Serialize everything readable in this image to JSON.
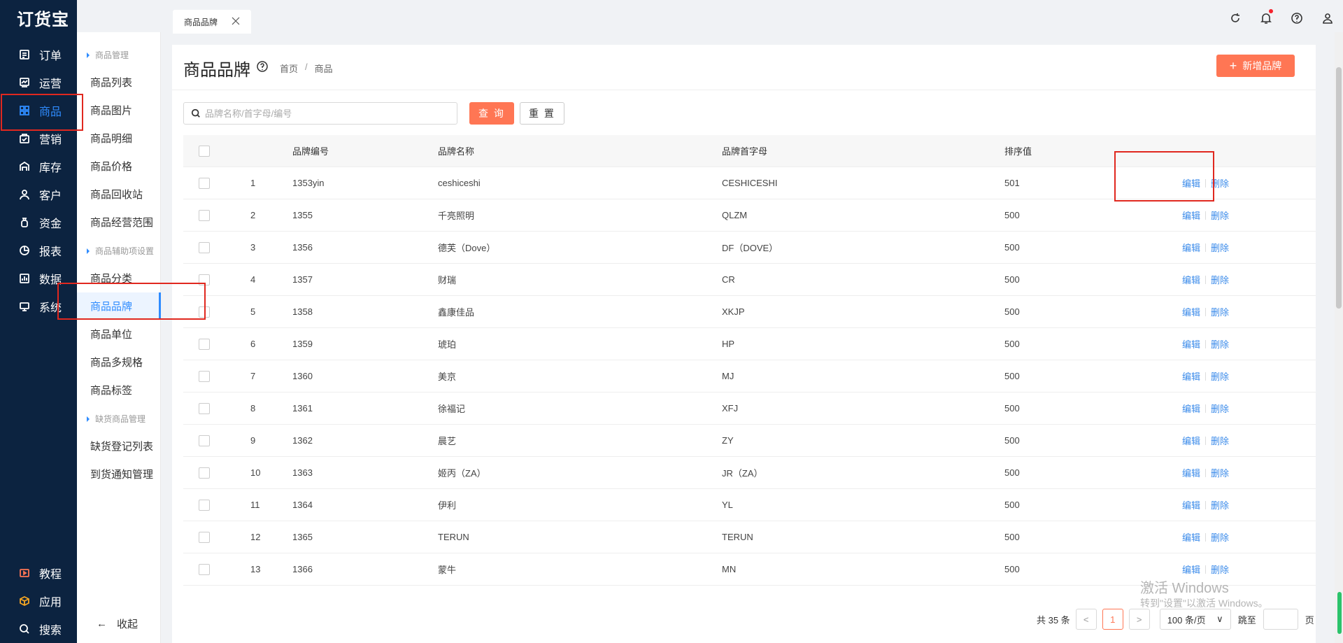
{
  "app": {
    "logo": "订货宝"
  },
  "nav": {
    "items": [
      {
        "label": "订单",
        "icon": "order-icon"
      },
      {
        "label": "运营",
        "icon": "operation-icon"
      },
      {
        "label": "商品",
        "icon": "product-grid-icon"
      },
      {
        "label": "营销",
        "icon": "marketing-icon"
      },
      {
        "label": "库存",
        "icon": "warehouse-icon"
      },
      {
        "label": "客户",
        "icon": "customer-icon"
      },
      {
        "label": "资金",
        "icon": "money-bag-icon"
      },
      {
        "label": "报表",
        "icon": "pie-chart-icon"
      },
      {
        "label": "数据",
        "icon": "data-icon"
      },
      {
        "label": "系统",
        "icon": "monitor-icon"
      }
    ],
    "bottom": [
      {
        "label": "教程",
        "icon": "play-icon"
      },
      {
        "label": "应用",
        "icon": "cube-icon"
      },
      {
        "label": "搜索",
        "icon": "search-icon"
      }
    ]
  },
  "submenu": {
    "groups": [
      "商品管理",
      "商品辅助项设置",
      "缺货商品管理"
    ],
    "items": [
      "商品列表",
      "商品图片",
      "商品明细",
      "商品价格",
      "商品回收站",
      "商品经营范围",
      "商品分类",
      "商品品牌",
      "商品单位",
      "商品多规格",
      "商品标签",
      "缺货登记列表",
      "到货通知管理"
    ],
    "collapse": "收起"
  },
  "tab": {
    "label": "商品品牌"
  },
  "page": {
    "title": "商品品牌",
    "breadcrumb": [
      "首页",
      "/",
      "商品"
    ],
    "add_button": "新增品牌",
    "search_placeholder": "品牌名称/首字母/编号",
    "query_button": "查 询",
    "reset_button": "重 置"
  },
  "table": {
    "headers": {
      "code": "品牌编号",
      "name": "品牌名称",
      "letter": "品牌首字母",
      "sort": "排序值"
    },
    "ops": {
      "edit": "编辑",
      "delete": "删除"
    },
    "rows": [
      {
        "idx": "1",
        "code": "1353yin",
        "name": "ceshiceshi",
        "letter": "CESHICESHI",
        "sort": "501"
      },
      {
        "idx": "2",
        "code": "1355",
        "name": "千亮照明",
        "letter": "QLZM",
        "sort": "500"
      },
      {
        "idx": "3",
        "code": "1356",
        "name": "德芙（Dove）",
        "letter": "DF（DOVE）",
        "sort": "500"
      },
      {
        "idx": "4",
        "code": "1357",
        "name": "财瑞",
        "letter": "CR",
        "sort": "500"
      },
      {
        "idx": "5",
        "code": "1358",
        "name": "鑫康佳品",
        "letter": "XKJP",
        "sort": "500"
      },
      {
        "idx": "6",
        "code": "1359",
        "name": "琥珀",
        "letter": "HP",
        "sort": "500"
      },
      {
        "idx": "7",
        "code": "1360",
        "name": "美京",
        "letter": "MJ",
        "sort": "500"
      },
      {
        "idx": "8",
        "code": "1361",
        "name": "徐福记",
        "letter": "XFJ",
        "sort": "500"
      },
      {
        "idx": "9",
        "code": "1362",
        "name": "晨艺",
        "letter": "ZY",
        "sort": "500"
      },
      {
        "idx": "10",
        "code": "1363",
        "name": "姬丙（ZA）",
        "letter": "JR（ZA）",
        "sort": "500"
      },
      {
        "idx": "11",
        "code": "1364",
        "name": "伊利",
        "letter": "YL",
        "sort": "500"
      },
      {
        "idx": "12",
        "code": "1365",
        "name": "TERUN",
        "letter": "TERUN",
        "sort": "500"
      },
      {
        "idx": "13",
        "code": "1366",
        "name": "蒙牛",
        "letter": "MN",
        "sort": "500"
      }
    ]
  },
  "pager": {
    "total": "共 35 条",
    "current": "1",
    "page_size": "100 条/页",
    "jump": "跳至",
    "page_unit": "页"
  },
  "watermark": {
    "line1": "激活 Windows",
    "line2": "转到\"设置\"以激活 Windows。"
  },
  "colors": {
    "nav_bg": "#0c2340",
    "accent": "#ff7654",
    "link": "#3b8bea",
    "active": "#2f8cff"
  }
}
